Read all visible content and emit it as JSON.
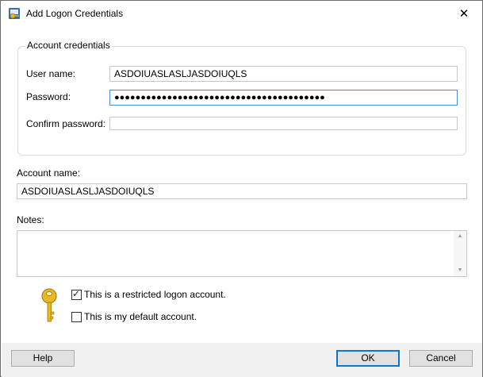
{
  "window": {
    "title": "Add Logon Credentials",
    "close_glyph": "✕"
  },
  "account_credentials": {
    "legend": "Account credentials",
    "user_name_label": "User name:",
    "user_name_value": "ASDOIUASLASLJASDOIUQLS",
    "password_label": "Password:",
    "password_value": "●●●●●●●●●●●●●●●●●●●●●●●●●●●●●●●●●●●●●●●●",
    "confirm_password_label": "Confirm password:",
    "confirm_password_value": ""
  },
  "account_name": {
    "label": "Account name:",
    "value": "ASDOIUASLASLJASDOIUQLS"
  },
  "notes": {
    "label": "Notes:",
    "value": ""
  },
  "options": {
    "restricted_label": "This is a restricted logon account.",
    "restricted_checked": true,
    "default_label": "This is my default account.",
    "default_checked": false
  },
  "buttons": {
    "help": "Help",
    "ok": "OK",
    "cancel": "Cancel"
  },
  "icons": {
    "title": "credentials-app-icon",
    "key": "key-icon"
  }
}
